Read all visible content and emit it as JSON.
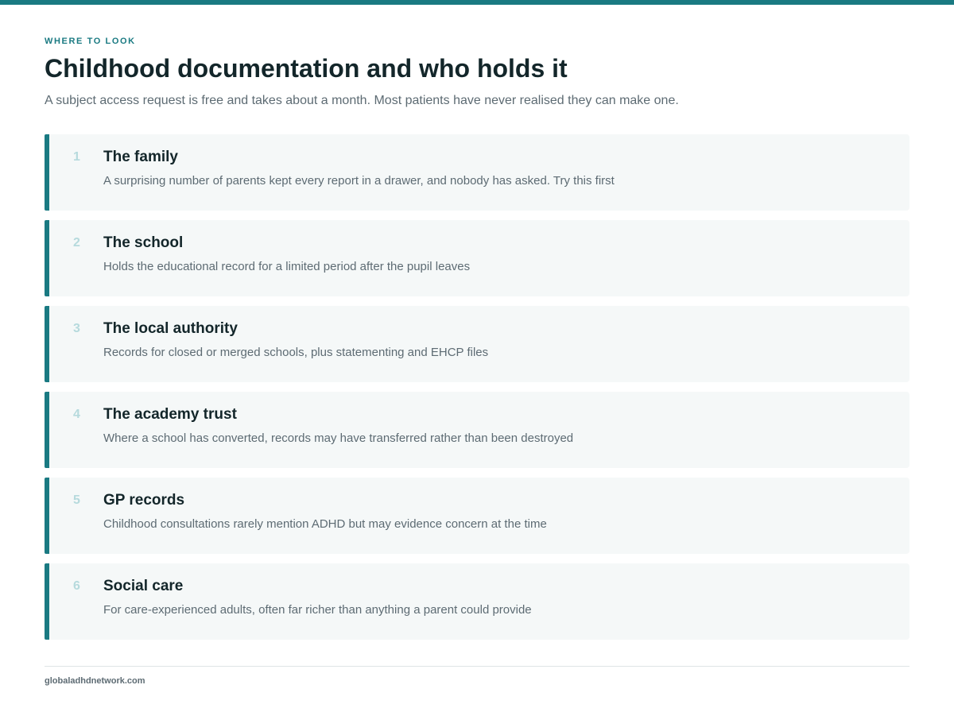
{
  "header": {
    "eyebrow": "WHERE TO LOOK",
    "title": "Childhood documentation and who holds it",
    "subtitle": "A subject access request is free and takes about a month. Most patients have never realised they can make one."
  },
  "sources": [
    {
      "number": "1",
      "title": "The family",
      "description": "A surprising number of parents kept every report in a drawer, and nobody has asked. Try this first"
    },
    {
      "number": "2",
      "title": "The school",
      "description": "Holds the educational record for a limited period after the pupil leaves"
    },
    {
      "number": "3",
      "title": "The local authority",
      "description": "Records for closed or merged schools, plus statementing and EHCP files"
    },
    {
      "number": "4",
      "title": "The academy trust",
      "description": "Where a school has converted, records may have transferred rather than been destroyed"
    },
    {
      "number": "5",
      "title": "GP records",
      "description": "Childhood consultations rarely mention ADHD but may evidence concern at the time"
    },
    {
      "number": "6",
      "title": "Social care",
      "description": "For care-experienced adults, often far richer than anything a parent could provide"
    }
  ],
  "footer": {
    "site": "globaladhdnetwork.com"
  },
  "colors": {
    "accent": "#1a7a82",
    "heading": "#13262a",
    "body_text": "#5d6b73",
    "card_background": "#f5f8f8",
    "number": "#b6dadd"
  }
}
